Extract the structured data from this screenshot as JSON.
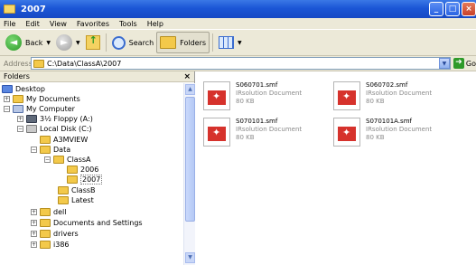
{
  "window": {
    "title": "2007"
  },
  "menu": [
    "File",
    "Edit",
    "View",
    "Favorites",
    "Tools",
    "Help"
  ],
  "toolbar": {
    "back_label": "Back",
    "search_label": "Search",
    "folders_label": "Folders"
  },
  "address": {
    "label": "Address",
    "path": "C:\\Data\\ClassA\\2007",
    "go_label": "Go"
  },
  "folders_pane": {
    "title": "Folders",
    "tree": {
      "desktop": "Desktop",
      "my_documents": "My Documents",
      "my_computer": "My Computer",
      "floppy": "3½ Floppy (A:)",
      "local_disk": "Local Disk (C:)",
      "a3mview": "A3MVIEW",
      "data": "Data",
      "classa": "ClassA",
      "y2006": "2006",
      "y2007": "2007",
      "classb": "ClassB",
      "latest": "Latest",
      "dell": "dell",
      "docs_settings": "Documents and Settings",
      "drivers": "drivers",
      "i386": "i386"
    }
  },
  "files": [
    {
      "name": "S060701.smf",
      "type": "IRsolution Document",
      "size": "80 KB"
    },
    {
      "name": "S060702.smf",
      "type": "IRsolution Document",
      "size": "80 KB"
    },
    {
      "name": "S070101.smf",
      "type": "IRsolution Document",
      "size": "80 KB"
    },
    {
      "name": "S070101A.smf",
      "type": "IRsolution Document",
      "size": "80 KB"
    }
  ],
  "colors": {
    "titlebar": "#1b56d6",
    "chrome": "#ece9d8",
    "selection": "#316ac5"
  }
}
